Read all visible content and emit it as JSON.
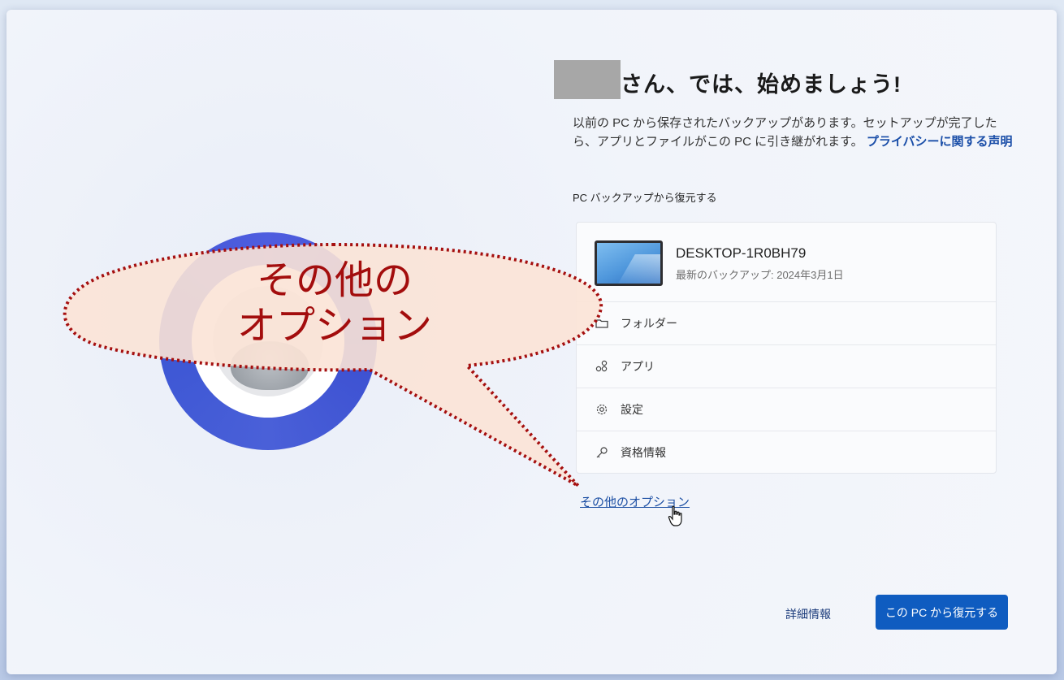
{
  "header": {
    "heading": "さん、では、始めましょう!"
  },
  "intro": {
    "description": "以前の PC から保存されたバックアップがあります。セットアップが完了したら、アプリとファイルがこの PC に引き継がれます。",
    "privacy_link": "プライバシーに関する声明"
  },
  "restore_section": {
    "label": "PC バックアップから復元する",
    "device": {
      "name": "DESKTOP-1R0BH79",
      "last_backup": "最新のバックアップ: 2024年3月1日"
    },
    "items": [
      {
        "label": "フォルダー",
        "icon": "folder-icon"
      },
      {
        "label": "アプリ",
        "icon": "apps-icon"
      },
      {
        "label": "設定",
        "icon": "gear-icon"
      },
      {
        "label": "資格情報",
        "icon": "key-icon"
      }
    ]
  },
  "more_options_link": "その他のオプション",
  "footer": {
    "learn_more": "詳細情報",
    "restore_button": "この PC から復元する"
  },
  "annotation": {
    "callout_line1": "その他の",
    "callout_line2": "オプション"
  },
  "colors": {
    "accent": "#0f5cc0",
    "link": "#1b4ea3",
    "ring": "#4a5cd8",
    "callout_fill": "#fbe3d6",
    "callout_text": "#a30d0d"
  }
}
